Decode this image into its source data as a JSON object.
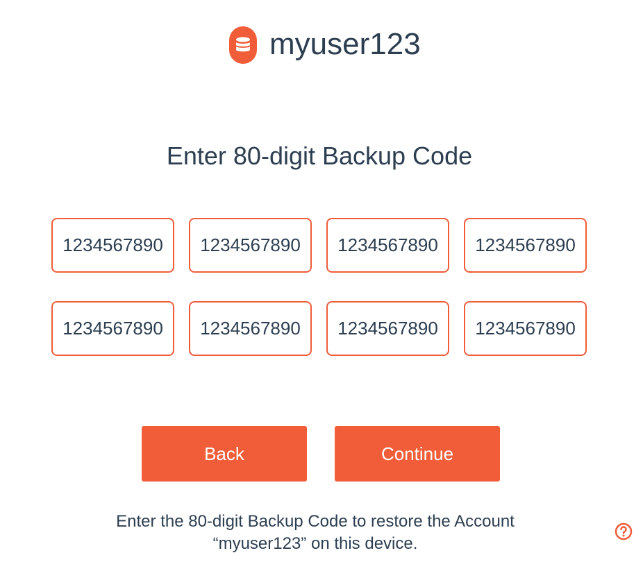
{
  "header": {
    "username": "myuser123",
    "logo_icon": "database-icon"
  },
  "title": "Enter 80-digit Backup Code",
  "codes": [
    "1234567890",
    "1234567890",
    "1234567890",
    "1234567890",
    "1234567890",
    "1234567890",
    "1234567890",
    "1234567890"
  ],
  "buttons": {
    "back": "Back",
    "continue": "Continue"
  },
  "description": {
    "line1": "Enter the 80-digit Backup Code to restore the Account",
    "line2": "“myuser123” on this device."
  },
  "help_icon": "question-circle-icon",
  "colors": {
    "accent": "#f05d38",
    "text": "#2c3e50"
  }
}
